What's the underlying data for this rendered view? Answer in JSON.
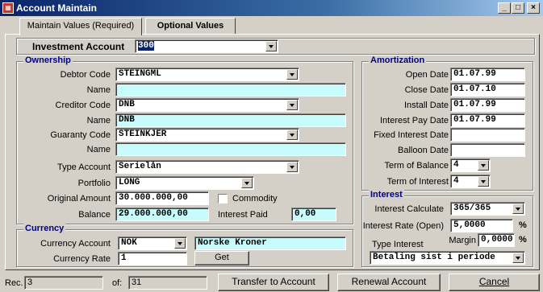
{
  "window": {
    "title": "Account Maintain",
    "app_icon": "grid-app-icon"
  },
  "tabs": [
    {
      "label": "Maintain Values (Required)",
      "active": true
    },
    {
      "label": "Optional Values",
      "active": false
    }
  ],
  "investment": {
    "label": "Investment Account",
    "value": "300"
  },
  "ownership": {
    "title": "Ownership",
    "debtor_code_label": "Debtor Code",
    "debtor_code": "STEINGML",
    "debtor_name_label": "Name",
    "debtor_name": "",
    "creditor_code_label": "Creditor Code",
    "creditor_code": "DNB",
    "creditor_name_label": "Name",
    "creditor_name": "DNB",
    "guaranty_code_label": "Guaranty Code",
    "guaranty_code": "STEINKJER",
    "guaranty_name_label": "Name",
    "guaranty_name": "",
    "type_account_label": "Type Account",
    "type_account": "Serielån",
    "portfolio_label": "Portfolio",
    "portfolio": "LONG",
    "original_amount_label": "Original Amount",
    "original_amount": "30.000.000,00",
    "commodity_label": "Commodity",
    "commodity_checked": false,
    "balance_label": "Balance",
    "balance": "29.000.000,00",
    "interest_paid_label": "Interest Paid",
    "interest_paid": "0,00"
  },
  "currency": {
    "title": "Currency",
    "account_label": "Currency Account",
    "account": "NOK",
    "account_name": "Norske Kroner",
    "rate_label": "Currency Rate",
    "rate": "1",
    "get_label": "Get"
  },
  "amortization": {
    "title": "Amortization",
    "open_date_label": "Open Date",
    "open_date": "01.07.99",
    "close_date_label": "Close Date",
    "close_date": "01.07.10",
    "install_date_label": "Install Date",
    "install_date": "01.07.99",
    "interest_pay_date_label": "Interest Pay Date",
    "interest_pay_date": "01.07.99",
    "fixed_interest_date_label": "Fixed Interest Date",
    "fixed_interest_date": "",
    "balloon_date_label": "Balloon Date",
    "balloon_date": "",
    "term_balance_label": "Term of Balance",
    "term_balance": "4",
    "term_interest_label": "Term of Interest",
    "term_interest": "4"
  },
  "interest": {
    "title": "Interest",
    "calculate_label": "Interest Calculate",
    "calculate": "365/365",
    "rate_label": "Interest Rate (Open)",
    "rate": "5,0000",
    "rate_unit": "%",
    "margin_label": "Margin",
    "margin": "0,0000",
    "margin_unit": "%",
    "type_label": "Type Interest",
    "type": "Betaling sist i periode"
  },
  "status": {
    "rec_label": "Rec.",
    "rec_value": "3",
    "of_label": "of:",
    "of_value": "31"
  },
  "buttons": {
    "transfer": "Transfer to Account",
    "renewal": "Renewal Account",
    "cancel": "Cancel"
  },
  "colors": {
    "title_bar": "#0a246a",
    "readonly_field": "#c8fcfc",
    "group_title": "#000080"
  }
}
